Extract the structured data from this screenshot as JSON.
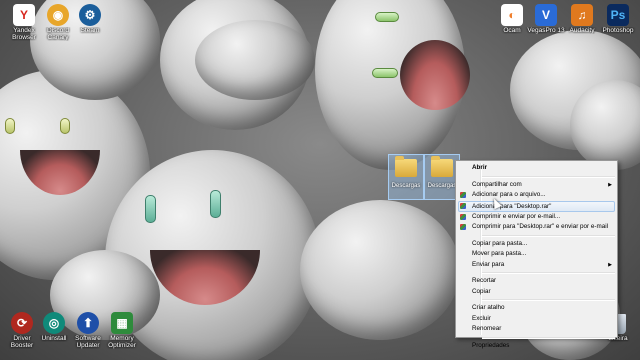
{
  "desktop": {
    "left_icons": [
      {
        "label": "Yandex\nBrowser",
        "icon": "yandex-icon",
        "color": "#d7261e",
        "glyph": "Y"
      },
      {
        "label": "Discord\nCanary",
        "icon": "discord-icon",
        "color": "#e8a62a",
        "glyph": "◉"
      },
      {
        "label": "Steam",
        "icon": "steam-icon",
        "color": "#1b5e9b",
        "glyph": "⚙"
      }
    ],
    "right_icons": [
      {
        "label": "Ocam",
        "icon": "ocam-icon",
        "color": "#ef7d2a",
        "glyph": "◐"
      },
      {
        "label": "VegasPro 13",
        "icon": "vegas-icon",
        "color": "#2a6bd6",
        "glyph": "V"
      },
      {
        "label": "Audacity",
        "icon": "audacity-icon",
        "color": "#e0791e",
        "glyph": "♫"
      },
      {
        "label": "Photoshop",
        "icon": "photoshop-icon",
        "color": "#0a2a5e",
        "glyph": "Ps"
      }
    ],
    "bottom_icons": [
      {
        "label": "Driver\nBooster",
        "icon": "driver-booster-icon",
        "color": "#b0281f",
        "glyph": "⟳"
      },
      {
        "label": "Uninstall",
        "icon": "uninstall-icon",
        "color": "#0f8a7a",
        "glyph": "◎"
      },
      {
        "label": "Software\nUpdater",
        "icon": "software-updater-icon",
        "color": "#1e4fa8",
        "glyph": "⬆"
      },
      {
        "label": "Memory\nOptimizer",
        "icon": "memory-optimizer-icon",
        "color": "#2e8b3c",
        "glyph": "▦"
      }
    ],
    "recycle_bin_label": "Lixeira",
    "selected_folders": [
      {
        "label": "Descargas"
      },
      {
        "label": "Descargas"
      }
    ]
  },
  "context_menu": {
    "open": "Abrir",
    "share_with": "Compartilhar com",
    "add_to_archive": "Adicionar para o arquivo...",
    "add_to_rar": "Adicionar para \"Desktop.rar\"",
    "compress_email": "Comprimir e enviar por e-mail...",
    "compress_rar_email": "Comprimir para \"Desktop.rar\" e enviar por e-mail",
    "copy_to_folder": "Copiar para pasta...",
    "move_to_folder": "Mover para pasta...",
    "send_to": "Enviar para",
    "cut": "Recortar",
    "copy": "Copiar",
    "create_shortcut": "Criar atalho",
    "delete": "Excluir",
    "rename": "Renomear",
    "properties": "Propriedades"
  }
}
